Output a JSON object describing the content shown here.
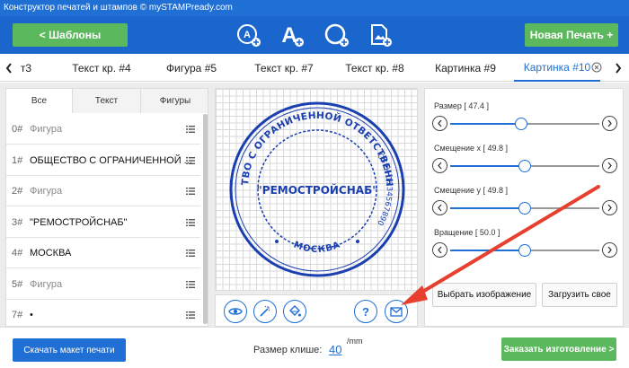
{
  "window": {
    "title": "Конструктор печатей и штампов © mySTAMPready.com"
  },
  "toolbar": {
    "back_label": "<  Шаблоны",
    "new_label": "Новая Печать +",
    "tools": [
      "add-text-circle-icon",
      "add-text-icon",
      "add-shape-icon",
      "add-image-icon"
    ]
  },
  "tabs": [
    {
      "label": "т3"
    },
    {
      "label": "Текст кр. #4"
    },
    {
      "label": "Фигура #5"
    },
    {
      "label": "Текст кр. #7"
    },
    {
      "label": "Текст кр. #8"
    },
    {
      "label": "Картинка #9"
    },
    {
      "label": "Картинка #10",
      "active": true
    }
  ],
  "left_panel": {
    "tabs": [
      "Все",
      "Текст",
      "Фигуры"
    ],
    "items": [
      {
        "num": "0#",
        "label": "Фигура",
        "dark": false
      },
      {
        "num": "1#",
        "label": "ОБЩЕСТВО С ОГРАНИЧЕННОЙ ...",
        "dark": true
      },
      {
        "num": "2#",
        "label": "Фигура",
        "dark": false
      },
      {
        "num": "3#",
        "label": "\"РЕМОСТРОЙСНАБ\"",
        "dark": true
      },
      {
        "num": "4#",
        "label": "МОСКВА",
        "dark": true
      },
      {
        "num": "5#",
        "label": "Фигура",
        "dark": false
      },
      {
        "num": "7#",
        "label": "•",
        "dark": true
      }
    ]
  },
  "stamp": {
    "outer_text": "ОБЩЕСТВО С ОГРАНИЧЕННОЙ ОТВЕТСТВЕННОСТЬЮ",
    "ogrn_text": "ОГРН 1234567890",
    "center_text": "\"РЕМОСТРОЙСНАБ\"",
    "city_text": "МОСКВА",
    "color": "#1a3fb0"
  },
  "canvas_tools": [
    "eye-icon",
    "magic-wand-icon",
    "paint-bucket-icon",
    "help-icon",
    "mail-icon"
  ],
  "sliders": [
    {
      "label": "Размер [ 47.4 ]",
      "value": 47.4
    },
    {
      "label": "Смещение x [ 49.8 ]",
      "value": 49.8
    },
    {
      "label": "Смещение y [ 49.8 ]",
      "value": 49.8
    },
    {
      "label": "Вращение [ 50.0 ]",
      "value": 50.0
    }
  ],
  "right_panel": {
    "choose_image": "Выбрать изображение",
    "upload_own": "Загрузить свое"
  },
  "bottom": {
    "download_label": "Скачать макет печати",
    "size_label": "Размер клише:",
    "size_value": "40",
    "size_unit": "/mm",
    "order_label": "Заказать изготовление >"
  },
  "colors": {
    "accent": "#1f6fd4",
    "green": "#5cb85c",
    "annotation": "#e8402f"
  }
}
